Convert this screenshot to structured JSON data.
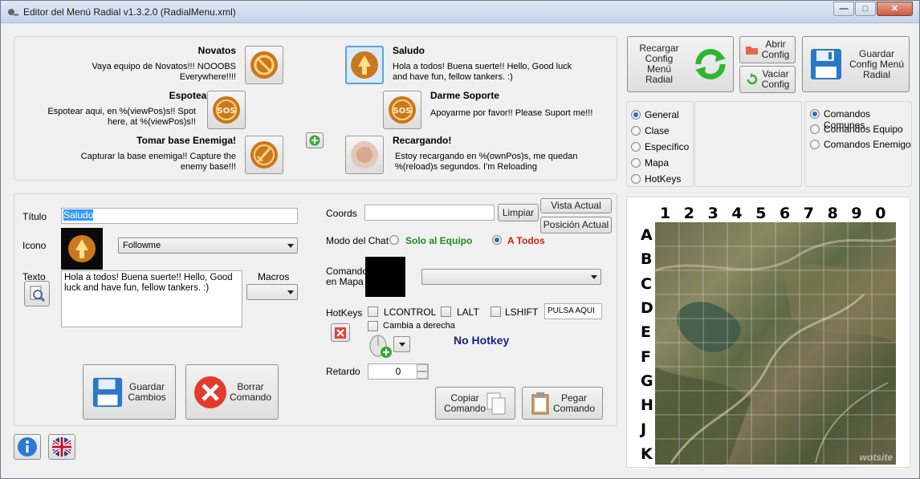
{
  "window": {
    "title": "Editor del Menú Radial v1.3.2.0 (RadialMenu.xml)",
    "minimize": "—",
    "maximize": "□",
    "close": "✕"
  },
  "commands": [
    {
      "title": "Novatos",
      "text": "Vaya equipo de Novatos!!! NOOOBS Everywhere!!!!",
      "icon": "no-icon"
    },
    {
      "title": "Saludo",
      "text": "Hola a todos! Buena suerte!! Hello, Good luck and have fun, fellow tankers. :)",
      "icon": "fire-arrow-icon"
    },
    {
      "title": "Espotear aqui!",
      "text": "Espotear aqui, en %(viewPos)s!! Spot here, at %(viewPos)s!!",
      "icon": "sos-icon"
    },
    {
      "title": "Darme Soporte",
      "text": "Apoyarme por favor!! Please Suport me!!!",
      "icon": "sos-icon"
    },
    {
      "title": "Tomar base Enemiga!",
      "text": "Capturar la base enemiga!! Capture the enemy base!!!",
      "icon": "sword-icon"
    },
    {
      "title": "Recargando!",
      "text": "Estoy recargando en %(ownPos)s, me quedan %(reload)s segundos.  I'm Reloading",
      "icon": "reload-icon"
    }
  ],
  "toolbar": {
    "reload": "Recargar Config Menú Radial",
    "open": "Abrir Config",
    "empty": "Vaciar Config",
    "save": "Guardar Config Menú Radial"
  },
  "groups": {
    "left": [
      "General",
      "Clase",
      "Específico",
      "Mapa",
      "HotKeys"
    ],
    "right": [
      "Comandos Comunes",
      "Comandos Equipo",
      "Comandos Enemigo"
    ],
    "left_selected": "General",
    "right_selected": "Comandos Comunes"
  },
  "editor": {
    "title_label": "Título",
    "title_value": "Saludo",
    "icon_label": "Icono",
    "icon_value": "Followme",
    "text_label": "Texto",
    "text_value": "Hola a todos! Buena suerte!! Hello, Good luck and have fun, fellow tankers. :)",
    "macros_label": "Macros",
    "save": "Guardar Cambios",
    "delete": "Borrar Comando",
    "coords_label": "Coords",
    "clear": "Limpiar",
    "current_view": "Vista Actual",
    "current_pos": "Posición Actual",
    "chat_label": "Modo del Chat",
    "chat_team": "Solo al Equipo",
    "chat_all": "A Todos",
    "chat_selected": "A Todos",
    "map_cmd_label": "Comando en Mapa",
    "hotkeys_label": "HotKeys",
    "lcontrol": "LCONTROL",
    "lalt": "LALT",
    "lshift": "LSHIFT",
    "press_here": "PULSA AQUI",
    "swap_right": "Cambia a derecha",
    "no_hotkey": "No Hotkey",
    "delay_label": "Retardo",
    "delay_value": "0",
    "copy": "Copiar Comando",
    "paste": "Pegar Comando"
  },
  "map": {
    "cols": [
      "1",
      "2",
      "3",
      "4",
      "5",
      "6",
      "7",
      "8",
      "9",
      "0"
    ],
    "rows": [
      "A",
      "B",
      "C",
      "D",
      "E",
      "F",
      "G",
      "H",
      "J",
      "K"
    ],
    "watermark": "wotsite"
  },
  "colors": {
    "team": "#1d8a2a",
    "all": "#d11a1a",
    "nohotkey": "#1a237e"
  }
}
